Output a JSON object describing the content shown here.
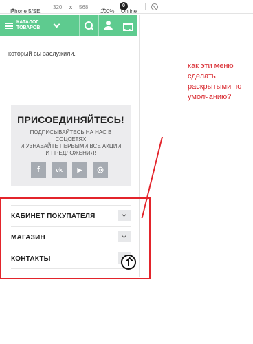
{
  "devtools": {
    "device": "iPhone 5/SE",
    "width": "320",
    "times": "x",
    "height": "568",
    "zoom": "100%",
    "network": "Online"
  },
  "header": {
    "catalog_line1": "КАТАЛОГ",
    "catalog_line2": "ТОВАРОВ",
    "cart_count": "0",
    "bg_color": "#5ecb8f"
  },
  "content": {
    "trailing_text": "который вы заслужили."
  },
  "join": {
    "title": "ПРИСОЕДИНЯЙТЕСЬ!",
    "line1": "ПОДПИСЫВАЙТЕСЬ НА НАС В",
    "line2": "СОЦСЕТЯХ",
    "line3": "И УЗНАВАЙТЕ ПЕРВЫМИ ВСЕ АКЦИИ",
    "line4": "И ПРЕДЛОЖЕНИЯ!",
    "socials": [
      {
        "icon": "facebook-icon",
        "glyph": "f"
      },
      {
        "icon": "vk-icon",
        "glyph": "vk"
      },
      {
        "icon": "youtube-icon",
        "glyph": "▶"
      },
      {
        "icon": "instagram-icon",
        "glyph": "◎"
      }
    ]
  },
  "accordion": [
    {
      "label": "КАБИНЕТ ПОКУПАТЕЛЯ"
    },
    {
      "label": "МАГАЗИН"
    },
    {
      "label": "КОНТАКТЫ"
    }
  ],
  "annotation": {
    "note": "как эти меню сделать раскрытыми по умолчанию?",
    "color": "#e3242b"
  }
}
